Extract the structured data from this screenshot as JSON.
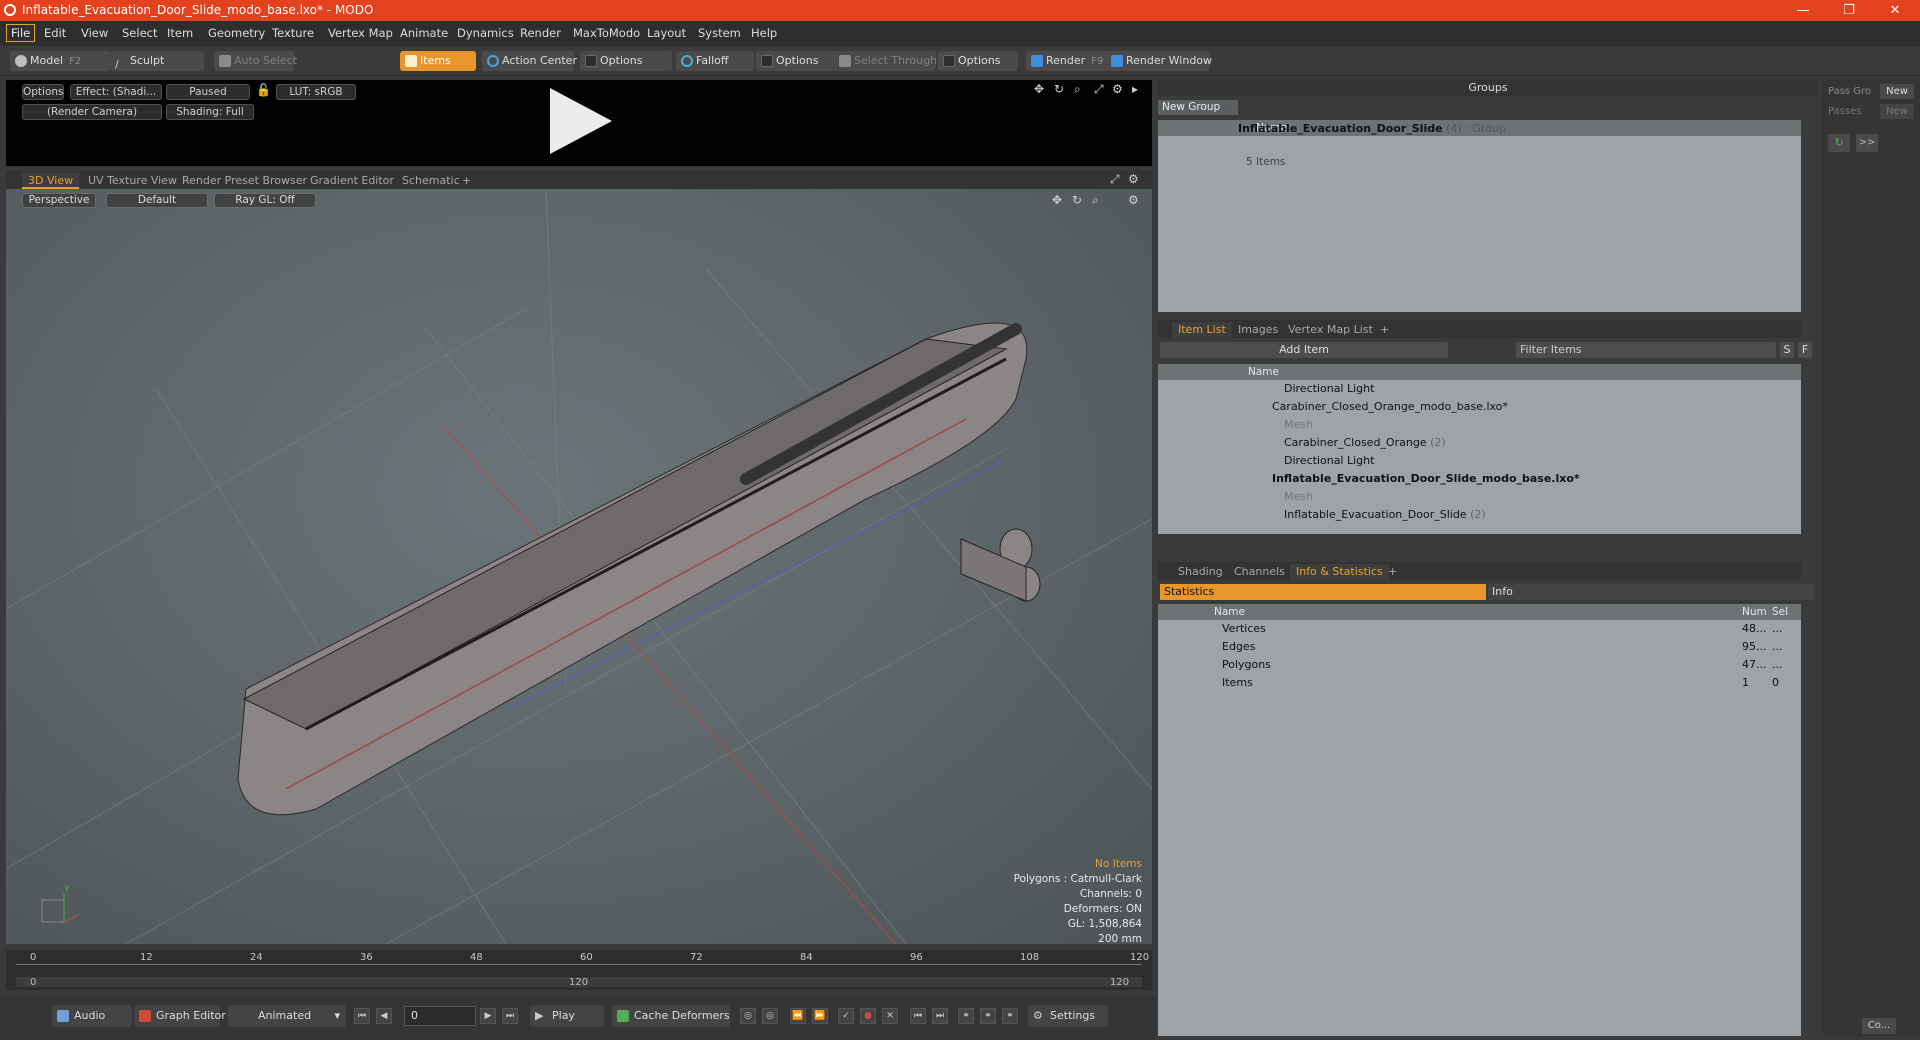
{
  "window": {
    "title": "Inflatable_Evacuation_Door_Slide_modo_base.lxo* - MODO",
    "min": "—",
    "max": "❐",
    "close": "✕"
  },
  "menu": [
    "File",
    "Edit",
    "View",
    "Select",
    "Item",
    "Geometry",
    "Texture",
    "Vertex Map",
    "Animate",
    "Dynamics",
    "Render",
    "MaxToModo",
    "Layout",
    "System",
    "Help"
  ],
  "toolbar": {
    "model": "Model",
    "model_key": "F2",
    "sculpt": "Sculpt",
    "auto_select": "Auto Select",
    "items": "Items",
    "action_center": "Action Center",
    "options1": "Options",
    "falloff": "Falloff",
    "options2": "Options",
    "select_through": "Select Through",
    "options3": "Options",
    "render": "Render",
    "render_key": "F9",
    "render_window": "Render Window"
  },
  "preview": {
    "options": "Options",
    "effect": "Effect: (Shadi...",
    "paused": "Paused",
    "lut": "LUT: sRGB",
    "camera": "(Render Camera)",
    "shading": "Shading: Full"
  },
  "viewport_tabs": [
    "3D View",
    "UV Texture View",
    "Render Preset Browser",
    "Gradient Editor",
    "Schematic",
    "+"
  ],
  "viewport": {
    "perspective": "Perspective",
    "default": "Default",
    "raygl": "Ray GL: Off",
    "stats": {
      "no_items": "No Items",
      "polygons": "Polygons : Catmull-Clark",
      "channels": "Channels: 0",
      "deformers": "Deformers: ON",
      "gl": "GL: 1,508,864",
      "size": "200 mm"
    }
  },
  "timeline": {
    "ticks": [
      "0",
      "12",
      "24",
      "36",
      "48",
      "60",
      "72",
      "84",
      "96",
      "108",
      "120"
    ],
    "start": "0",
    "mid": "120",
    "end": "120"
  },
  "bottom": {
    "audio": "Audio",
    "graph_editor": "Graph Editor",
    "animated": "Animated",
    "frame": "0",
    "play": "Play",
    "cache": "Cache Deformers",
    "settings": "Settings"
  },
  "groups": {
    "title": "Groups",
    "new_group": "New Group",
    "col_name": "Name",
    "item_name": "Inflatable_Evacuation_Door_Slide",
    "item_count": "(4)",
    "item_type": ": Group",
    "item_sub": "5 Items"
  },
  "pass": {
    "pass_gro": "Pass Gro",
    "new1": "New",
    "passes": "Passes",
    "new2": "New",
    "more": ">>"
  },
  "itemlist": {
    "tabs": [
      "Item List",
      "Images",
      "Vertex Map List",
      "+"
    ],
    "add_item": "Add Item",
    "filter": "Filter Items",
    "s": "S",
    "f": "F",
    "col_name": "Name",
    "rows": [
      {
        "label": "Directional Light",
        "suffix": ""
      },
      {
        "label": "Carabiner_Closed_Orange_modo_base.lxo*",
        "suffix": ""
      },
      {
        "label": "Mesh",
        "suffix": ""
      },
      {
        "label": "Carabiner_Closed_Orange",
        "suffix": "(2)"
      },
      {
        "label": "Directional Light",
        "suffix": ""
      },
      {
        "label": "Inflatable_Evacuation_Door_Slide_modo_base.lxo*",
        "suffix": ""
      },
      {
        "label": "Mesh",
        "suffix": ""
      },
      {
        "label": "Inflatable_Evacuation_Door_Slide",
        "suffix": "(2)"
      }
    ]
  },
  "info": {
    "tabs": [
      "Shading",
      "Channels",
      "Info & Statistics",
      "+"
    ],
    "statistics": "Statistics",
    "info": "Info",
    "col_name": "Name",
    "col_num": "Num",
    "col_sel": "Sel",
    "rows": [
      {
        "name": "Vertices",
        "num": "48...",
        "sel": "..."
      },
      {
        "name": "Edges",
        "num": "95...",
        "sel": "..."
      },
      {
        "name": "Polygons",
        "num": "47...",
        "sel": "..."
      },
      {
        "name": "Items",
        "num": "1",
        "sel": "0"
      }
    ]
  },
  "right_strip": {
    "co": "Co..."
  }
}
